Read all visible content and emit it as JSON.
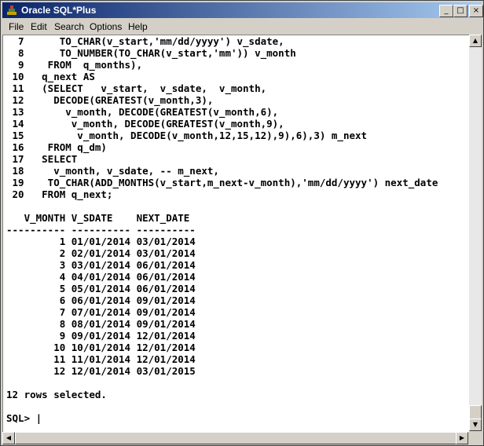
{
  "window": {
    "title": "Oracle SQL*Plus",
    "buttons": {
      "minimize": "_",
      "maximize": "□",
      "close": "×"
    }
  },
  "menu": [
    {
      "label": "File"
    },
    {
      "label": "Edit"
    },
    {
      "label": "Search"
    },
    {
      "label": "Options"
    },
    {
      "label": "Help"
    }
  ],
  "console": {
    "lines": [
      "  7      TO_CHAR(v_start,'mm/dd/yyyy') v_sdate,",
      "  8      TO_NUMBER(TO_CHAR(v_start,'mm')) v_month",
      "  9    FROM  q_months),",
      " 10   q_next AS",
      " 11   (SELECT   v_start,  v_sdate,  v_month,",
      " 12     DECODE(GREATEST(v_month,3),",
      " 13       v_month, DECODE(GREATEST(v_month,6),",
      " 14        v_month, DECODE(GREATEST(v_month,9),",
      " 15         v_month, DECODE(v_month,12,15,12),9),6),3) m_next",
      " 16    FROM q_dm)",
      " 17   SELECT",
      " 18     v_month, v_sdate, -- m_next,",
      " 19    TO_CHAR(ADD_MONTHS(v_start,m_next-v_month),'mm/dd/yyyy') next_date",
      " 20   FROM q_next;",
      "",
      "   V_MONTH V_SDATE    NEXT_DATE",
      "---------- ---------- ----------",
      "         1 01/01/2014 03/01/2014",
      "         2 02/01/2014 03/01/2014",
      "         3 03/01/2014 06/01/2014",
      "         4 04/01/2014 06/01/2014",
      "         5 05/01/2014 06/01/2014",
      "         6 06/01/2014 09/01/2014",
      "         7 07/01/2014 09/01/2014",
      "         8 08/01/2014 09/01/2014",
      "         9 09/01/2014 12/01/2014",
      "        10 10/01/2014 12/01/2014",
      "        11 11/01/2014 12/01/2014",
      "        12 12/01/2014 03/01/2015",
      "",
      "12 rows selected.",
      "",
      "SQL> |"
    ]
  },
  "scrollbar": {
    "up": "▲",
    "down": "▼",
    "left": "◀",
    "right": "▶"
  }
}
